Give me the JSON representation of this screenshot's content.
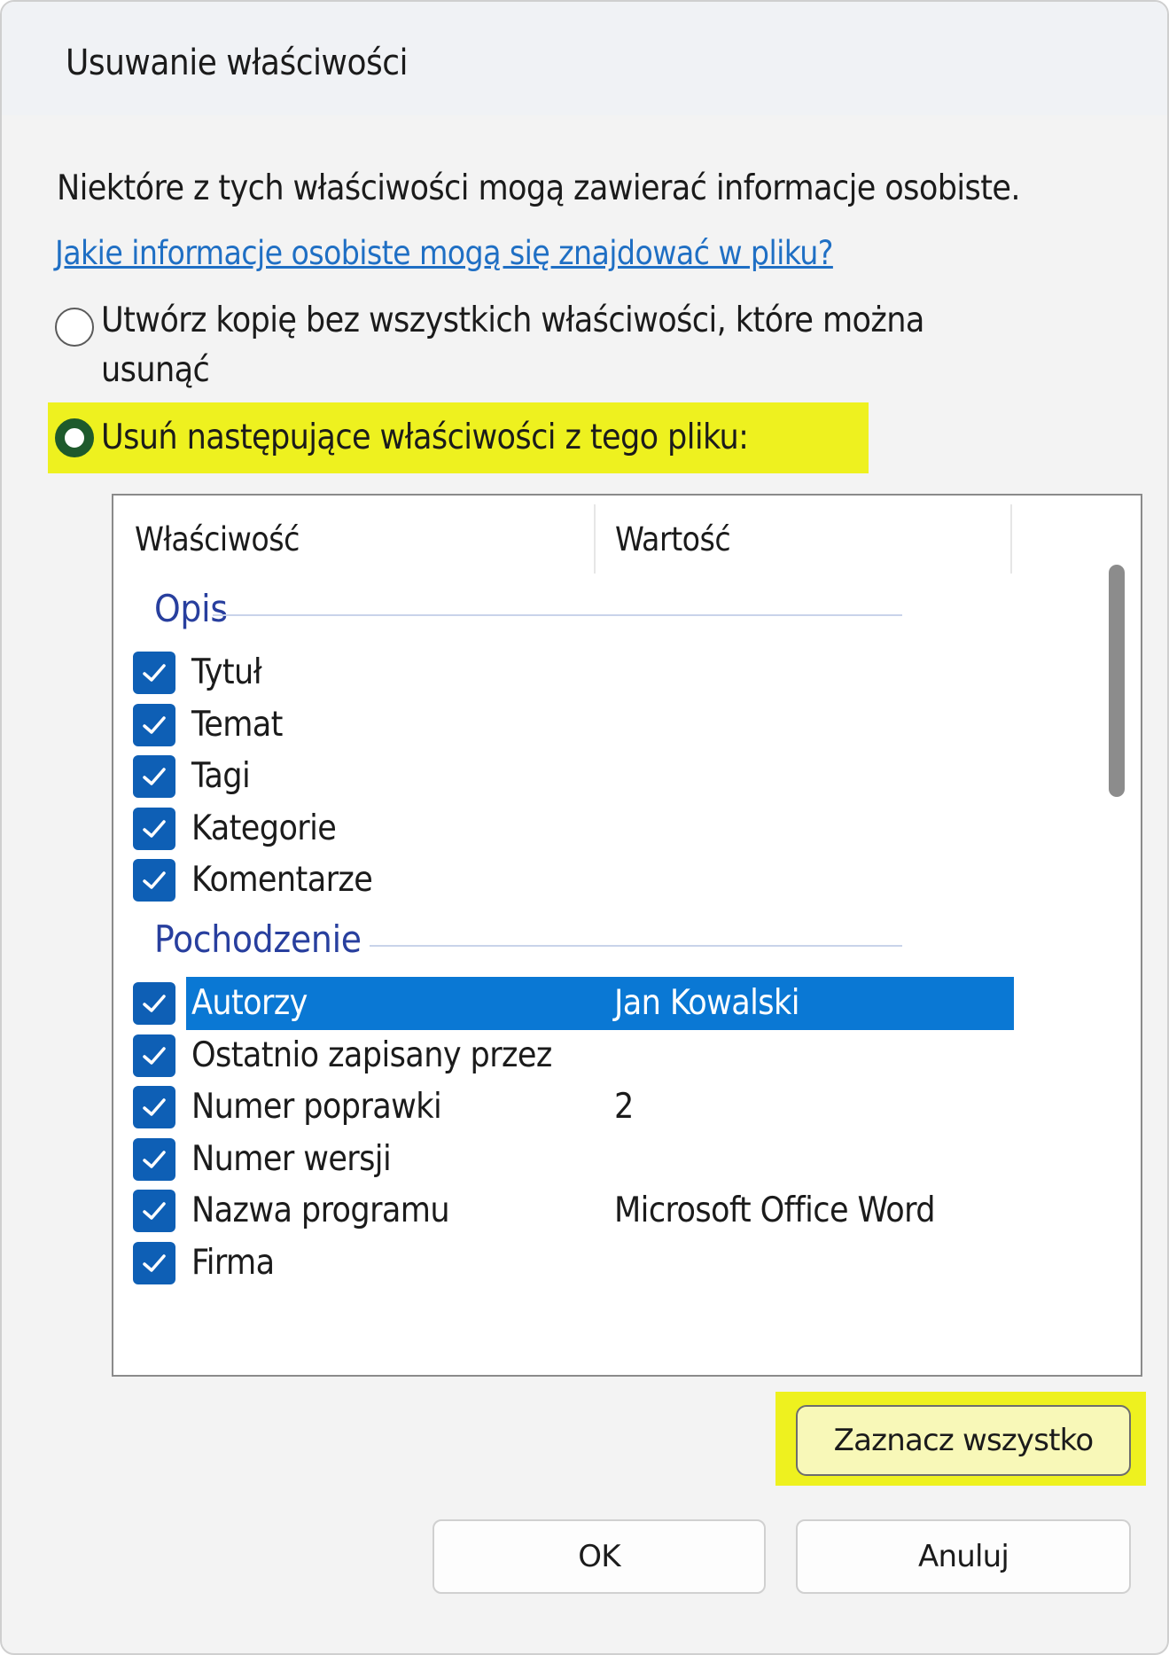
{
  "dialog": {
    "title": "Usuwanie właściwości",
    "intro": "Niektóre z tych właściwości mogą zawierać informacje osobiste.",
    "help_link": "Jakie informacje osobiste mogą się znajdować w pliku?",
    "option_copy_line1": "Utwórz kopię bez wszystkich właściwości, które można",
    "option_copy_line2": "usunąć",
    "option_remove": "Usuń następujące właściwości z tego pliku:",
    "selected_option": "remove"
  },
  "list": {
    "col_property": "Właściwość",
    "col_value": "Wartość",
    "groups": [
      {
        "name": "Opis",
        "items": [
          {
            "name": "Tytuł",
            "value": "",
            "checked": true
          },
          {
            "name": "Temat",
            "value": "",
            "checked": true
          },
          {
            "name": "Tagi",
            "value": "",
            "checked": true
          },
          {
            "name": "Kategorie",
            "value": "",
            "checked": true
          },
          {
            "name": "Komentarze",
            "value": "",
            "checked": true
          }
        ]
      },
      {
        "name": "Pochodzenie",
        "items": [
          {
            "name": "Autorzy",
            "value": "Jan Kowalski",
            "checked": true,
            "selected": true
          },
          {
            "name": "Ostatnio zapisany przez",
            "value": "",
            "checked": true
          },
          {
            "name": "Numer poprawki",
            "value": "2",
            "checked": true
          },
          {
            "name": "Numer wersji",
            "value": "",
            "checked": true
          },
          {
            "name": "Nazwa programu",
            "value": "Microsoft Office Word",
            "checked": true
          },
          {
            "name": "Firma",
            "value": "",
            "checked": true
          }
        ]
      }
    ]
  },
  "buttons": {
    "select_all": "Zaznacz wszystko",
    "ok": "OK",
    "cancel": "Anuluj"
  },
  "colors": {
    "highlight": "#eef11f",
    "checkbox": "#0e5fb5",
    "selection": "#0a78d4",
    "group_text": "#283f9e",
    "link": "#1f6fc4"
  }
}
